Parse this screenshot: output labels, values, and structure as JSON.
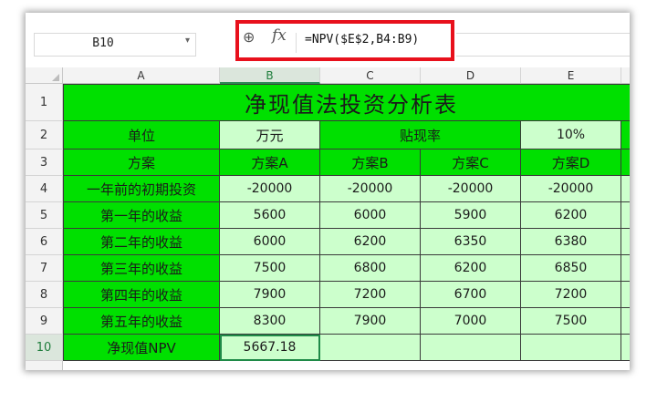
{
  "formula_bar": {
    "name_box": "B10",
    "fx_label": "fx",
    "formula": "=NPV($E$2,B4:B9)"
  },
  "columns": [
    "A",
    "B",
    "C",
    "D",
    "E"
  ],
  "rows": [
    "1",
    "2",
    "3",
    "4",
    "5",
    "6",
    "7",
    "8",
    "9",
    "10"
  ],
  "sheet": {
    "title": "净现值法投资分析表",
    "r2": {
      "a": "单位",
      "b": "万元",
      "c": "贴现率",
      "e": "10%"
    },
    "r3": [
      "方案",
      "方案A",
      "方案B",
      "方案C",
      "方案D"
    ],
    "r4": [
      "一年前的初期投资",
      "-20000",
      "-20000",
      "-20000",
      "-20000"
    ],
    "r5": [
      "第一年的收益",
      "5600",
      "6000",
      "5900",
      "6200"
    ],
    "r6": [
      "第二年的收益",
      "6000",
      "6200",
      "6350",
      "6380"
    ],
    "r7": [
      "第三年的收益",
      "7500",
      "6800",
      "6200",
      "6850"
    ],
    "r8": [
      "第四年的收益",
      "7900",
      "7200",
      "6700",
      "7200"
    ],
    "r9": [
      "第五年的收益",
      "8300",
      "7900",
      "7000",
      "7500"
    ],
    "r10": [
      "净现值NPV",
      "5667.18",
      "",
      "",
      ""
    ]
  },
  "colors": {
    "header_green": "#00e000",
    "cell_light_green": "#ccffcc",
    "highlight_red": "#e8101c"
  }
}
